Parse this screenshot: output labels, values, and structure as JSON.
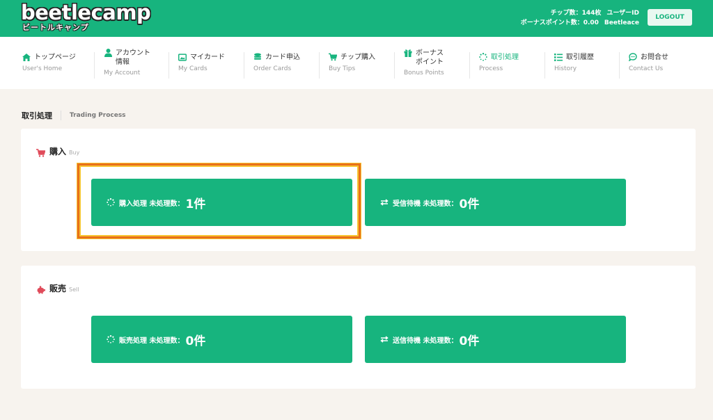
{
  "header": {
    "logo_main": "beetlecamp",
    "logo_sub": "ビートルキャンプ",
    "chips_label": "チップ数：144枚",
    "user_id_label": "ユーザーID",
    "bonus_label": "ボーナスポイント数：0.00",
    "user_id": "Beetleace",
    "logout": "LOGOUT"
  },
  "nav": [
    {
      "ja": "トップページ",
      "en": "User's Home",
      "icon": "home-icon"
    },
    {
      "ja": "アカウント\n情報",
      "en": "My Account",
      "icon": "user-icon"
    },
    {
      "ja": "マイカード",
      "en": "My Cards",
      "icon": "cards-icon"
    },
    {
      "ja": "カード申込",
      "en": "Order Cards",
      "icon": "coins-icon"
    },
    {
      "ja": "チップ購入",
      "en": "Buy Tips",
      "icon": "cart-icon"
    },
    {
      "ja": "ボーナス\nポイント",
      "en": "Bonus Points",
      "icon": "gift-icon"
    },
    {
      "ja": "取引処理",
      "en": "Process",
      "icon": "spinner-icon"
    },
    {
      "ja": "取引履歴",
      "en": "History",
      "icon": "list-icon"
    },
    {
      "ja": "お問合せ",
      "en": "Contact Us",
      "icon": "chat-icon"
    }
  ],
  "page": {
    "title_ja": "取引処理",
    "title_en": "Trading Process"
  },
  "buy": {
    "title": "購入",
    "title_en": "Buy",
    "tiles": [
      {
        "label": "購入処理 未処理数：",
        "count": "1件"
      },
      {
        "label": "受信待機 未処理数：",
        "count": "0件"
      }
    ]
  },
  "sell": {
    "title": "販売",
    "title_en": "Sell",
    "tiles": [
      {
        "label": "販売処理 未処理数：",
        "count": "0件"
      },
      {
        "label": "送信待機 未処理数：",
        "count": "0件"
      }
    ]
  },
  "colors": {
    "brand": "#17b47e",
    "accent_red": "#e04b5a",
    "highlight": "#e8701a"
  }
}
